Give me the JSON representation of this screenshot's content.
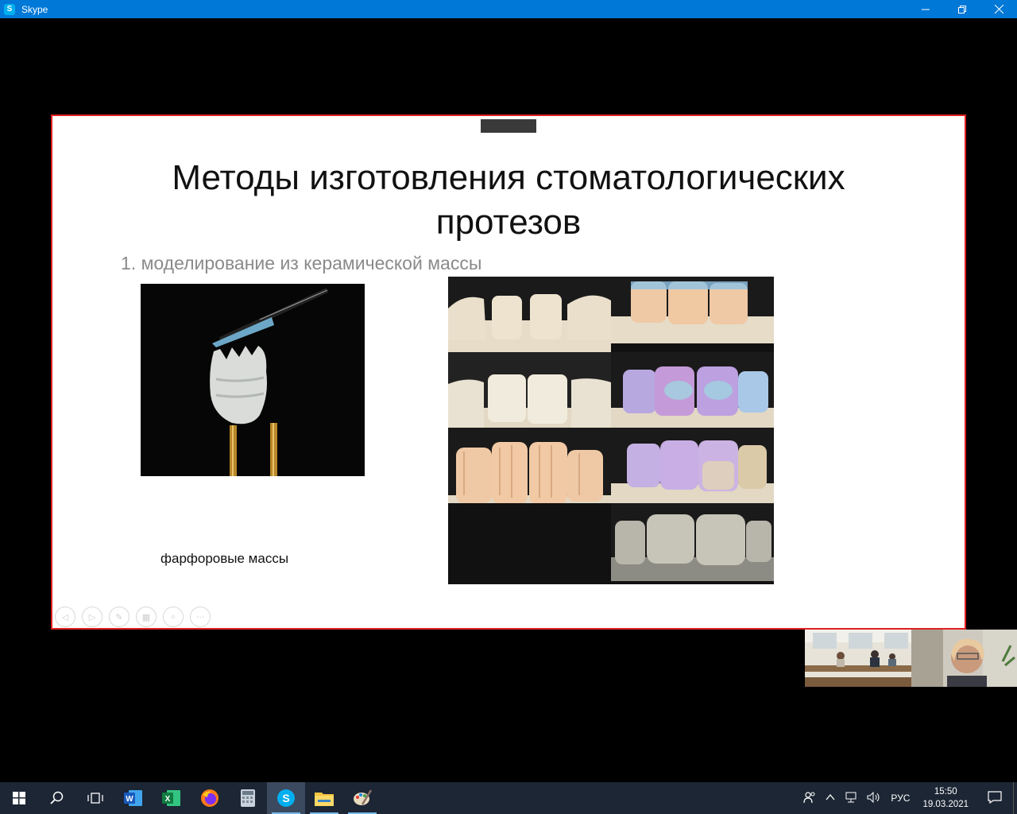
{
  "window": {
    "app_name": "Skype",
    "app_icon_letter": "S"
  },
  "slide": {
    "heading_line1": "Методы изготовления стоматологических",
    "heading_line2": "протезов",
    "bullet": "1. моделирование из керамической массы",
    "caption": "фарфоровые массы"
  },
  "taskbar": {
    "apps": [
      "start-icon",
      "search-icon",
      "task-view-icon",
      "word-icon",
      "excel-icon",
      "firefox-icon",
      "calculator-icon",
      "skype-icon",
      "file-explorer-icon",
      "paint-icon"
    ],
    "language": "РУС",
    "time": "15:50",
    "date": "19.03.2021"
  },
  "colors": {
    "titlebar": "#0078d7",
    "slide_border": "#e02020",
    "taskbar": "#1c2634"
  }
}
